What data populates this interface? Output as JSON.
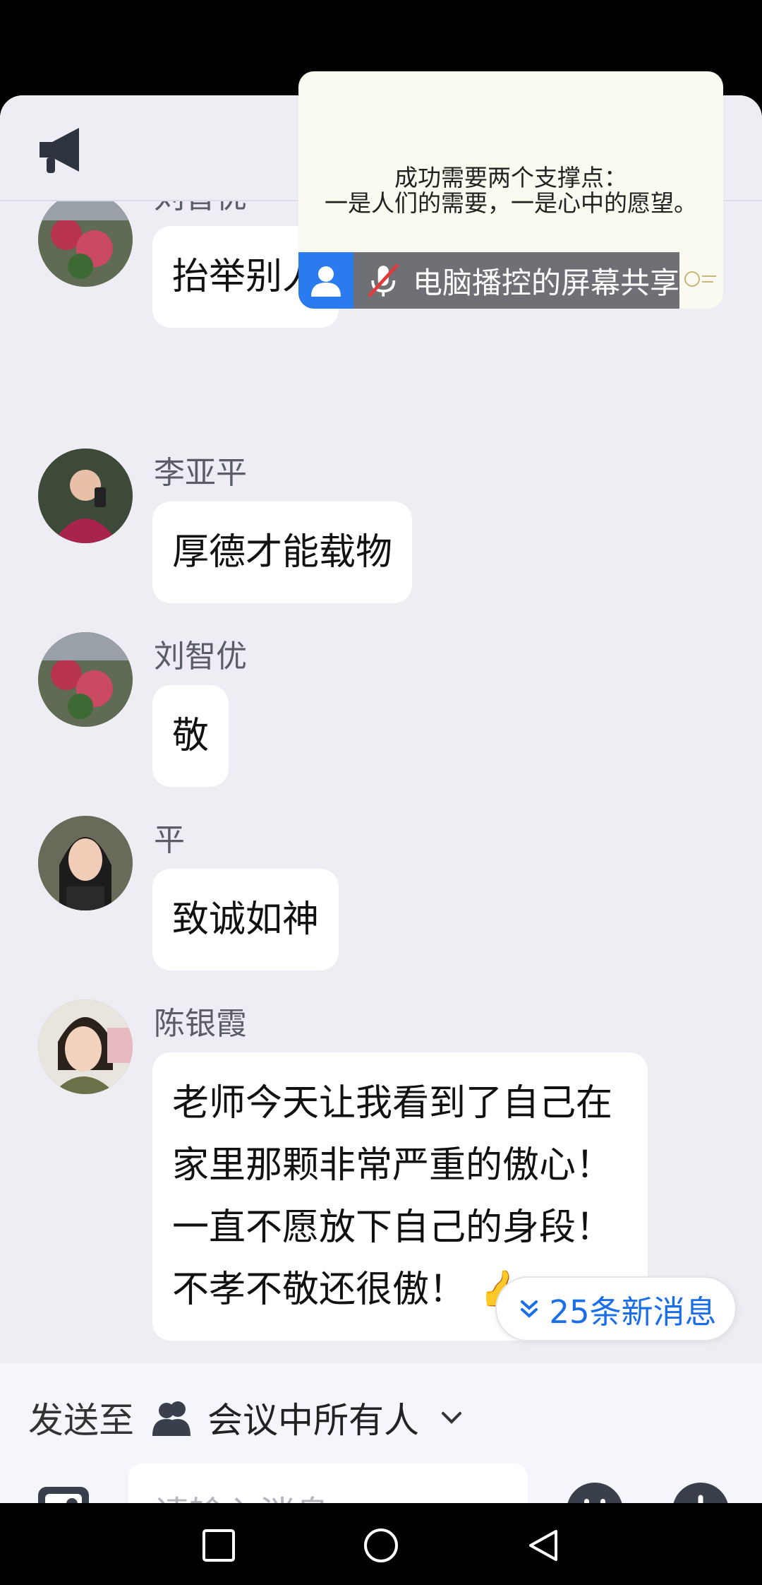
{
  "overlay": {
    "quote_line1": "成功需要两个支撑点：",
    "quote_line2": "一是人们的需要，一是心中的愿望。",
    "share_label": "电脑播控的屏幕共享",
    "accent": "#2b7bf0"
  },
  "messages": [
    {
      "sender": "刘智优",
      "text": "抬举别人"
    },
    {
      "sender": "李亚平",
      "text": "厚德才能载物"
    },
    {
      "sender": "刘智优",
      "text": "敬"
    },
    {
      "sender": "平",
      "text": "致诚如神"
    },
    {
      "sender": "陈银霞",
      "lines": [
        "老师今天让我看到了自己在",
        "家里那颗非常严重的傲心！",
        "一直不愿放下自己的身段！",
        "不孝不敬还很傲！"
      ]
    }
  ],
  "new_messages_label": "25条新消息",
  "composer": {
    "send_to_label": "发送至",
    "recipient": "会议中所有人",
    "input_placeholder": "请输入消息..."
  },
  "icons": {
    "announcement": "megaphone-icon",
    "recipient": "people-icon",
    "image": "image-icon",
    "emoji": "emoji-icon",
    "more": "plus-icon",
    "nav": [
      "recents-square-icon",
      "home-circle-icon",
      "back-triangle-icon"
    ]
  },
  "colors": {
    "link_blue": "#1a6ee8",
    "background": "#ededf3"
  }
}
